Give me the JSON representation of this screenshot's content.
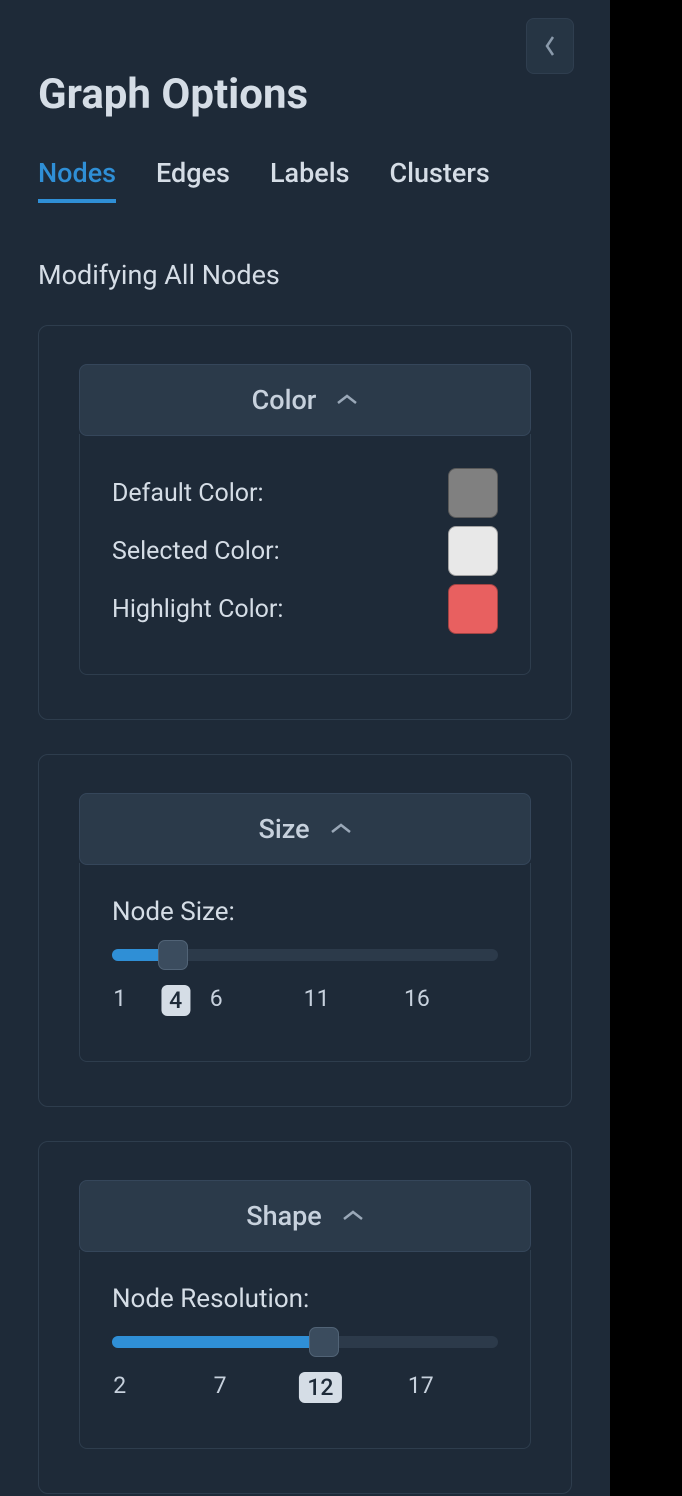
{
  "title": "Graph Options",
  "tabs": [
    "Nodes",
    "Edges",
    "Labels",
    "Clusters"
  ],
  "active_tab": 0,
  "subtitle": "Modifying All Nodes",
  "sections": {
    "color": {
      "title": "Color",
      "rows": [
        {
          "label": "Default Color:",
          "swatch": "#808080"
        },
        {
          "label": "Selected Color:",
          "swatch": "#e8e8e8"
        },
        {
          "label": "Highlight Color:",
          "swatch": "#e86060"
        }
      ]
    },
    "size": {
      "title": "Size",
      "slider": {
        "label": "Node Size:",
        "min": 1,
        "max": 20,
        "value": 4,
        "ticks": [
          1,
          6,
          11,
          16
        ],
        "current_tick": 4,
        "fill_pct": 15.8,
        "thumb_pct": 15.8,
        "tick_positions": {
          "1": 2,
          "4": 16.5,
          "6": 27,
          "11": 53,
          "16": 79
        }
      }
    },
    "shape": {
      "title": "Shape",
      "slider": {
        "label": "Node Resolution:",
        "min": 2,
        "max": 21,
        "value": 12,
        "ticks": [
          2,
          7,
          17
        ],
        "current_tick": 12,
        "fill_pct": 52.6,
        "thumb_pct": 55,
        "tick_positions": {
          "2": 2,
          "7": 28,
          "12": 54,
          "17": 80
        }
      }
    }
  }
}
